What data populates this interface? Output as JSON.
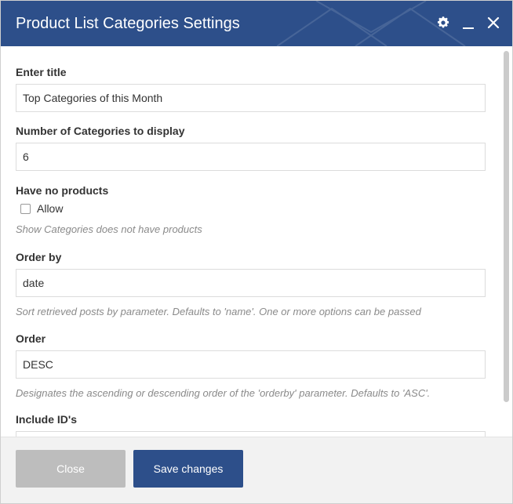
{
  "dialog": {
    "title": "Product List Categories Settings",
    "icons": [
      "gear-icon",
      "minimize-icon",
      "close-icon"
    ]
  },
  "fields": {
    "title": {
      "label": "Enter title",
      "value": "Top Categories of this Month"
    },
    "count": {
      "label": "Number of Categories to display",
      "value": "6"
    },
    "no_products": {
      "label": "Have no products",
      "checkbox_label": "Allow",
      "checked": false,
      "help": "Show Categories does not have products"
    },
    "orderby": {
      "label": "Order by",
      "value": "date",
      "help": "Sort retrieved posts by parameter. Defaults to 'name'. One or more options can be passed"
    },
    "order": {
      "label": "Order",
      "value": "DESC",
      "help": "Designates the ascending or descending order of the 'orderby' parameter. Defaults to 'ASC'."
    },
    "include": {
      "label": "Include ID's",
      "value": ""
    }
  },
  "footer": {
    "close_label": "Close",
    "save_label": "Save changes"
  },
  "colors": {
    "header": "#2d4f8a",
    "save_button": "#2d4f8a",
    "close_button": "#bdbdbd"
  }
}
